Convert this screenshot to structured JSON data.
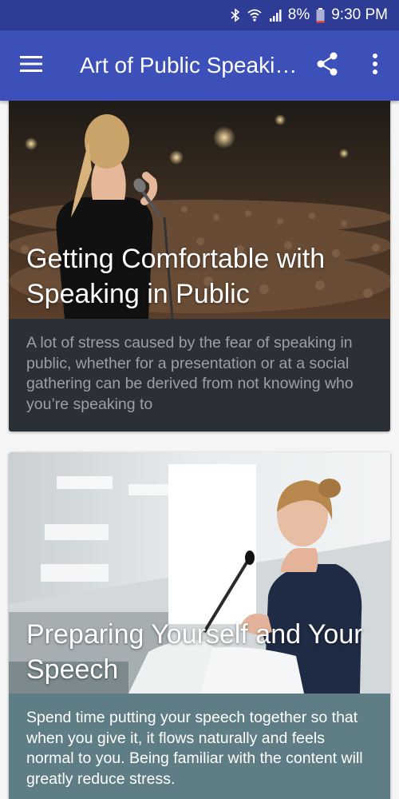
{
  "status_bar": {
    "battery": "8%",
    "time": "9:30 PM",
    "icons": [
      "bluetooth-icon",
      "wifi-icon",
      "signal-icon",
      "battery-icon"
    ]
  },
  "app_bar": {
    "title": "Art of Public Speaki…",
    "icons": [
      "menu-icon",
      "share-icon",
      "more-vert-icon"
    ],
    "color": "#3d4fb9",
    "status_color": "#2f3c96"
  },
  "cards": [
    {
      "title": "Getting Comfortable with Speaking in Public",
      "body": "A lot of stress caused by the fear of speaking in public, whether for a presentation or at a social gathering can be derived from not knowing who you’re speaking to",
      "body_bg": "#2b2f36"
    },
    {
      "title": "Preparing Yourself and Your Speech",
      "body": "Spend time putting your speech together so that when you give it, it flows naturally and feels normal to you. Being familiar with the content will greatly reduce stress.",
      "body_bg": "#5f7d84"
    }
  ]
}
